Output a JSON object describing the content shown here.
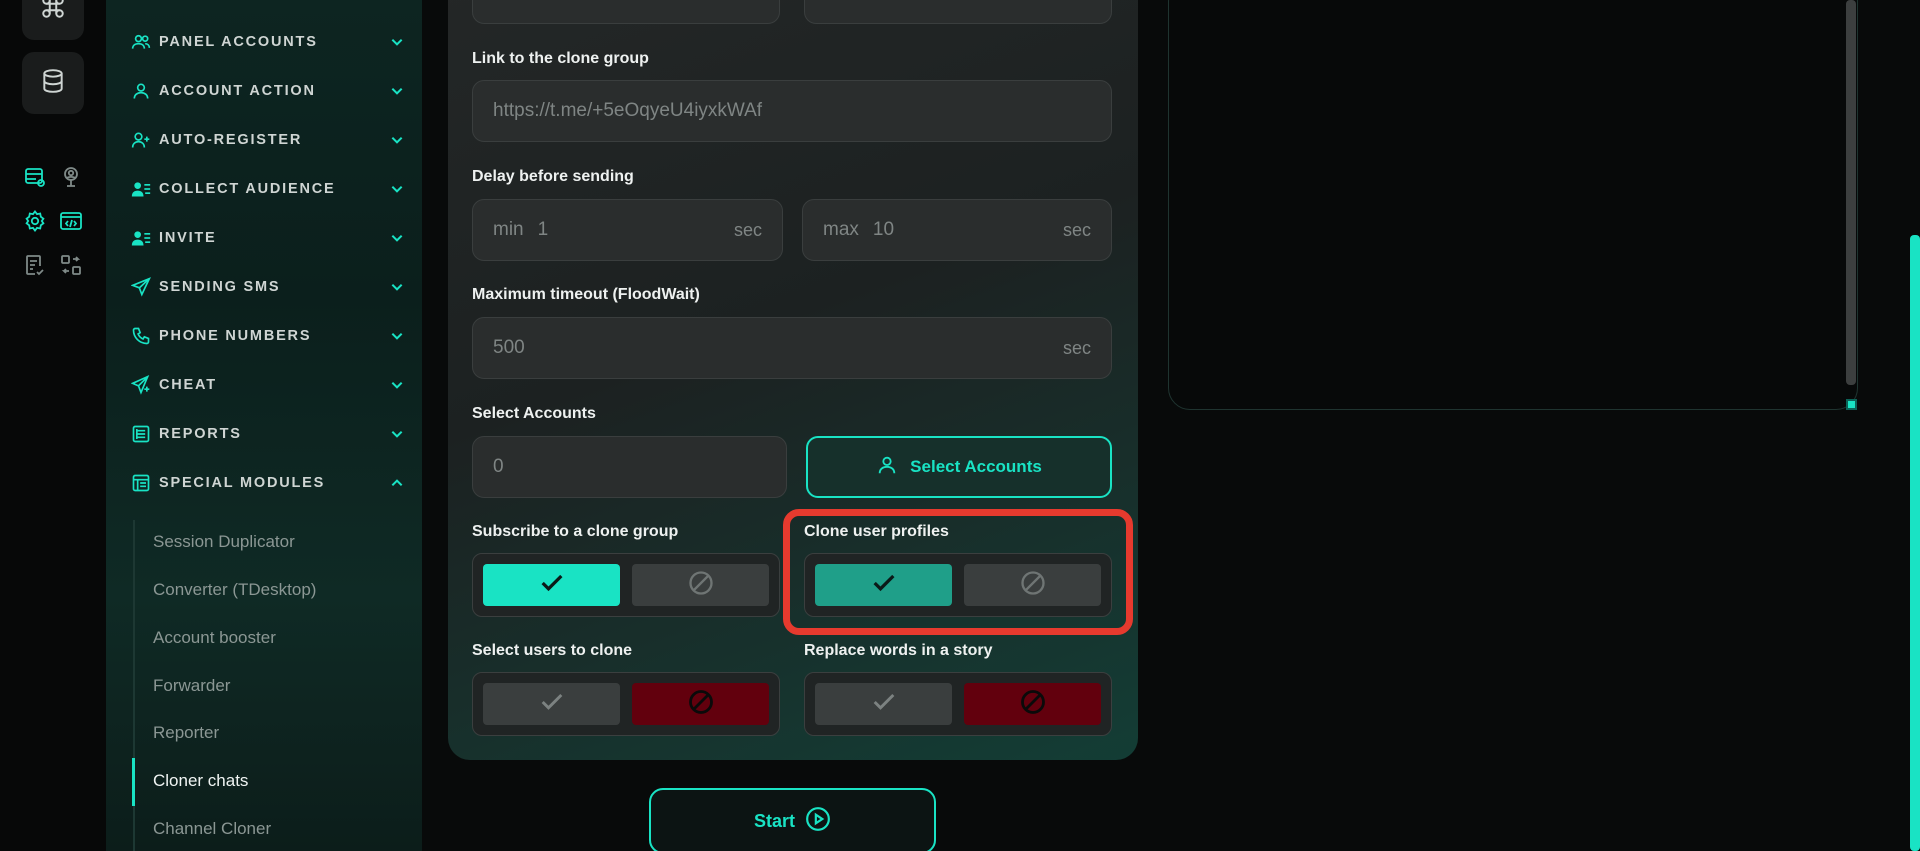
{
  "sidebar": {
    "items": [
      {
        "label": "PANEL ACCOUNTS",
        "icon": "users-icon"
      },
      {
        "label": "ACCOUNT ACTION",
        "icon": "user-icon"
      },
      {
        "label": "AUTO-REGISTER",
        "icon": "user-plus-icon"
      },
      {
        "label": "COLLECT AUDIENCE",
        "icon": "user-list-icon"
      },
      {
        "label": "INVITE",
        "icon": "user-list-icon"
      },
      {
        "label": "SENDING SMS",
        "icon": "paper-plane-icon"
      },
      {
        "label": "PHONE NUMBERS",
        "icon": "phone-icon"
      },
      {
        "label": "CHEAT",
        "icon": "send-plus-icon"
      },
      {
        "label": "REPORTS",
        "icon": "report-icon"
      },
      {
        "label": "SPECIAL MODULES",
        "icon": "modules-icon"
      }
    ],
    "submenu": [
      "Session Duplicator",
      "Converter (TDesktop)",
      "Account booster",
      "Forwarder",
      "Reporter",
      "Cloner chats",
      "Channel Cloner"
    ],
    "active_submenu": "Cloner chats"
  },
  "form": {
    "link_label": "Link to the clone group",
    "link_placeholder": "https://t.me/+5eOqyeU4iyxkWAf",
    "delay_label": "Delay before sending",
    "delay_min_prefix": "min",
    "delay_min_value": "1",
    "delay_max_prefix": "max",
    "delay_max_value": "10",
    "unit_sec": "sec",
    "timeout_label": "Maximum timeout (FloodWait)",
    "timeout_value": "500",
    "select_accounts_label": "Select Accounts",
    "accounts_count": "0",
    "select_accounts_button": "Select Accounts",
    "subscribe_label": "Subscribe to a clone group",
    "subscribe_value": true,
    "clone_profiles_label": "Clone user profiles",
    "clone_profiles_value": true,
    "select_users_label": "Select users to clone",
    "select_users_value": false,
    "replace_words_label": "Replace words in a story",
    "replace_words_value": false,
    "start_button": "Start"
  },
  "colors": {
    "accent": "#19e3c4",
    "accent_dim": "#1f9f89",
    "reject_red": "#62000d",
    "highlight": "#e63a2e"
  }
}
